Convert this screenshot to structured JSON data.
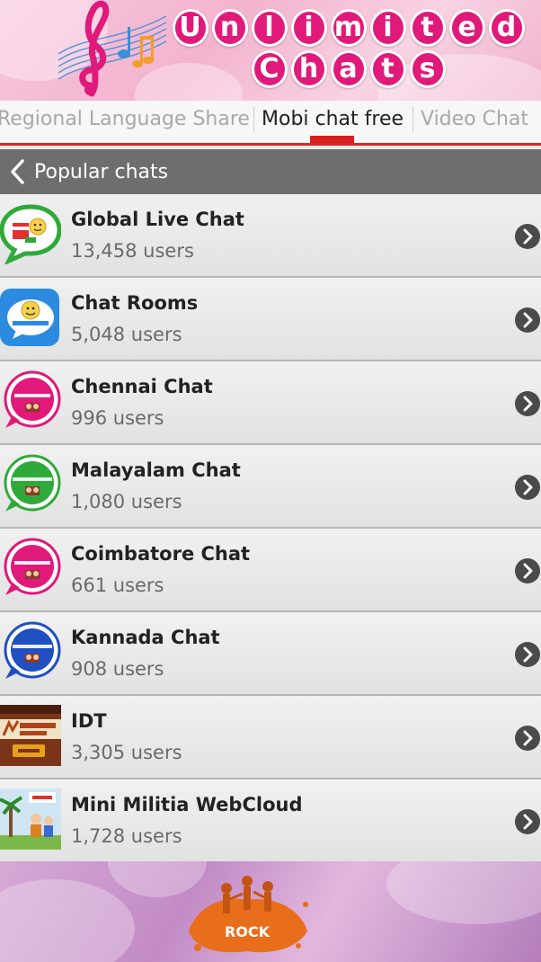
{
  "banner": {
    "title_line1": [
      "U",
      "n",
      "l",
      "i",
      "m",
      "i",
      "t",
      "e",
      "d"
    ],
    "title_line2": [
      "C",
      "h",
      "a",
      "t",
      "s"
    ]
  },
  "tabs": [
    {
      "label": "Regional Language Share",
      "active": false
    },
    {
      "label": "Mobi chat free",
      "active": true
    },
    {
      "label": "Video Chat",
      "active": false
    }
  ],
  "section": {
    "title": "Popular chats"
  },
  "chats": [
    {
      "name": "Global Live Chat",
      "users": "13,458 users",
      "icon": "green-chat-bubble-icon"
    },
    {
      "name": "Chat Rooms",
      "users": "5,048 users",
      "icon": "blue-chat-rooms-icon"
    },
    {
      "name": "Chennai Chat",
      "users": "996 users",
      "icon": "pink-tamil-chat-icon"
    },
    {
      "name": "Malayalam Chat",
      "users": "1,080 users",
      "icon": "green-malayalam-chat-icon"
    },
    {
      "name": "Coimbatore Chat",
      "users": "661 users",
      "icon": "pink-tamil-chat-icon"
    },
    {
      "name": "Kannada Chat",
      "users": "908 users",
      "icon": "blue-kannada-chat-icon"
    },
    {
      "name": "IDT",
      "users": "3,305 users",
      "icon": "intraday-tips-icon"
    },
    {
      "name": "Mini Militia WebCloud",
      "users": "1,728 users",
      "icon": "mini-militia-icon"
    }
  ],
  "footer": {
    "logo_text": "ROCK"
  },
  "colors": {
    "accent_red": "#d82020",
    "banner_pink": "#e0197a",
    "header_gray": "#6e6e6e",
    "chat_green": "#2faa3a",
    "chat_blue": "#1f6fd1",
    "chat_pink": "#e0197a",
    "rock_orange": "#e86e1c"
  }
}
